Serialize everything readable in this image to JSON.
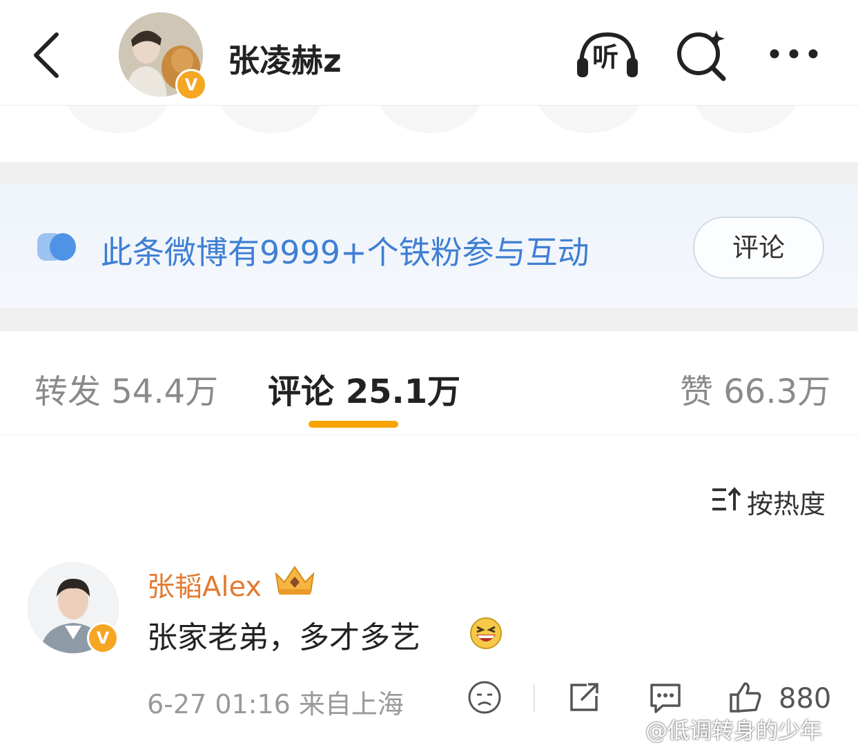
{
  "header": {
    "username": "张凌赫z",
    "listen_label": "听",
    "verified_mark": "V"
  },
  "banner": {
    "text": "此条微博有9999+个铁粉参与互动",
    "button_label": "评论"
  },
  "tabs": [
    {
      "label": "转发 54.4万",
      "active": false
    },
    {
      "label": "评论 25.1万",
      "active": true
    },
    {
      "label": "赞 66.3万",
      "active": false
    }
  ],
  "sort": {
    "label": "按热度"
  },
  "comment": {
    "author": "张韬Alex",
    "text": "张家老弟，多才多艺",
    "time_location": "6-27 01:16  来自上海",
    "like_count": "880",
    "verified_mark": "V"
  },
  "watermark": "@低调转身的少年",
  "colors": {
    "accent_orange": "#f7a400",
    "author_name": "#e27b32",
    "banner_text": "#3f7fd3"
  }
}
